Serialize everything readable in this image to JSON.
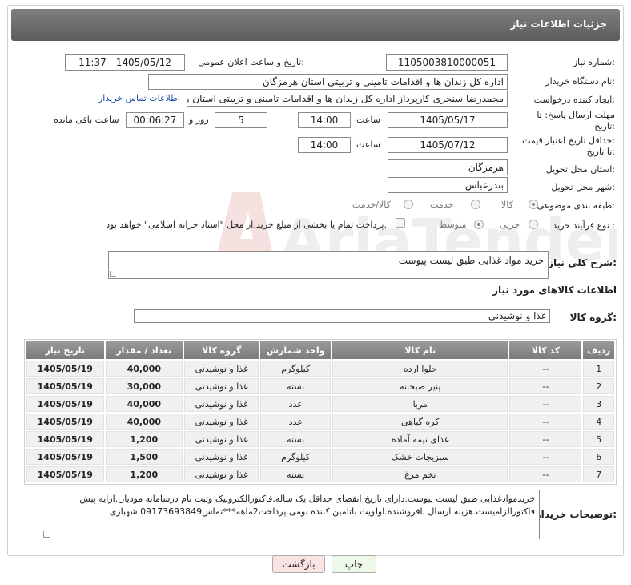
{
  "header": {
    "title": "جزئیات اطلاعات نیاز"
  },
  "form": {
    "need_number": {
      "label": "شماره نیاز:",
      "value": "1105003810000051"
    },
    "announce_datetime": {
      "label": "تاریخ و ساعت اعلان عمومی:",
      "value": "1405/05/12 - 11:37"
    },
    "buyer_org": {
      "label": "نام دستگاه خریدار:",
      "value": "اداره کل زندان ها و اقدامات تامینی و تربیتی استان هرمزگان"
    },
    "requester": {
      "label": "ایجاد کننده درخواست:",
      "value": "محمدرضا سنجری کارپرداز اداره کل زندان ها و اقدامات تامینی و تربیتی استان هر",
      "contact_link": "اطلاعات تماس خریدار"
    },
    "reply_deadline": {
      "label1": "مهلت ارسال پاسخ: تا",
      "label2": "تاریخ:",
      "date": "1405/05/17",
      "time_label": "ساعت",
      "time": "14:00",
      "days": "5",
      "days_label": "روز و",
      "remaining": "00:06:27",
      "remaining_label": "ساعت باقی مانده"
    },
    "price_validity": {
      "label1": "حداقل تاریخ اعتبار قیمت:",
      "label2": "تا تاریخ:",
      "date": "1405/07/12",
      "time_label": "ساعت",
      "time": "14:00"
    },
    "delivery_province": {
      "label": "استان محل تحویل:",
      "value": "هرمزگان"
    },
    "delivery_city": {
      "label": "شهر محل تحویل:",
      "value": "بندرعباس"
    },
    "category": {
      "label": "طبقه بندی موضوعی:",
      "options": [
        "کالا",
        "خدمت",
        "کالا/خدمت"
      ],
      "selected": "کالا"
    },
    "purchase_type": {
      "label": "نوع فرآیند خرید :",
      "options": [
        "جزیی",
        "متوسط"
      ],
      "selected": "جزیی",
      "treasury_note": "پرداخت تمام یا بخشی از مبلغ خرید،از محل \"اسناد خزانه اسلامی\" خواهد بود."
    }
  },
  "general_desc": {
    "label": "شرح کلی نیاز:",
    "value": "خرید مواد غذایی طبق لیست پیوست"
  },
  "goods_section": {
    "title": "اطلاعات کالاهای مورد نیاز",
    "group_label": "گروه کالا:",
    "group_value": "غذا و نوشیدنی"
  },
  "table": {
    "headers": [
      "ردیف",
      "کد کالا",
      "نام کالا",
      "واحد شمارش",
      "گروه کالا",
      "تعداد / مقدار",
      "تاریخ نیاز"
    ],
    "rows": [
      [
        "1",
        "--",
        "حلوا ارده",
        "کیلوگرم",
        "غذا و نوشیدنی",
        "40,000",
        "1405/05/19"
      ],
      [
        "2",
        "--",
        "پنیر صبحانه",
        "بسته",
        "غذا و نوشیدنی",
        "30,000",
        "1405/05/19"
      ],
      [
        "3",
        "--",
        "مربا",
        "عدد",
        "غذا و نوشیدنی",
        "40,000",
        "1405/05/19"
      ],
      [
        "4",
        "--",
        "کره گیاهی",
        "عدد",
        "غذا و نوشیدنی",
        "40,000",
        "1405/05/19"
      ],
      [
        "5",
        "--",
        "غذای نیمه آماده",
        "بسته",
        "غذا و نوشیدنی",
        "1,200",
        "1405/05/19"
      ],
      [
        "6",
        "--",
        "سبزیجات خشک",
        "کیلوگرم",
        "غذا و نوشیدنی",
        "1,500",
        "1405/05/19"
      ],
      [
        "7",
        "--",
        "تخم مرغ",
        "بسته",
        "غذا و نوشیدنی",
        "1,200",
        "1405/05/19"
      ]
    ]
  },
  "buyer_notes": {
    "label": "توضیحات خریدار:",
    "value": "خریدموادغذایی طبق لیست پیوست.دارای تاریخ انقضای حداقل یک ساله.فاکتورالکترونیک وثبت نام درسامانه مودیان.ارایه پیش فاکتورالزامیست.هزینه ارسال بافروشنده.اولویت باتامین کننده بومی.پرداخت2ماهه***تماس09173693849 شهبازی"
  },
  "buttons": {
    "print": "چاپ",
    "back": "بازگشت"
  },
  "watermark": {
    "text": "AriaTender.net"
  },
  "colors": {
    "header": "#6e6e6e",
    "link": "#1a4fa8",
    "back_button": "#fbe3e3",
    "print_button": "#eef8e8"
  }
}
